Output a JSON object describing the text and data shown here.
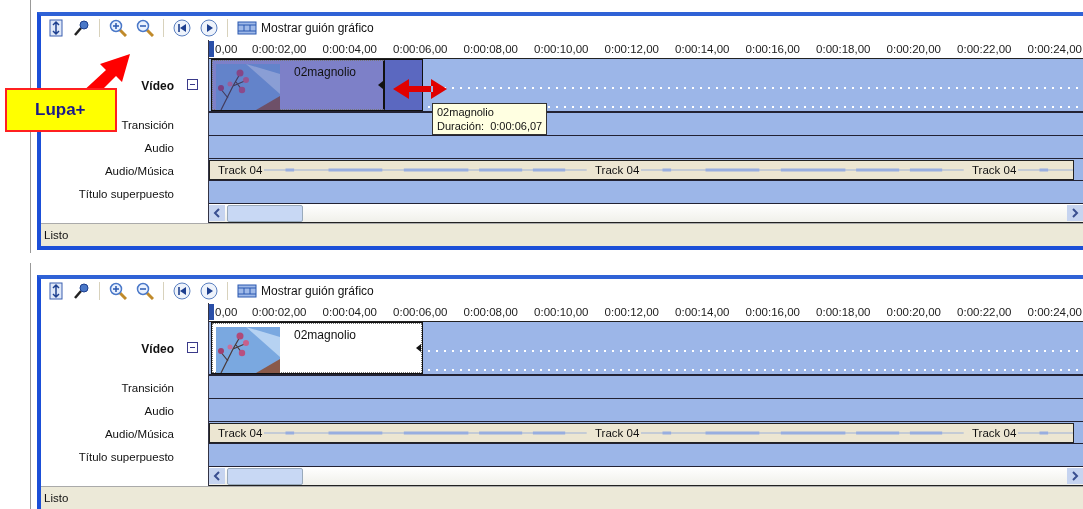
{
  "callout": {
    "text": "Lupa+"
  },
  "panels": [
    {
      "toolbar_label": "Mostrar guión gráfico",
      "ruler": [
        "0,00",
        "0:00:02,00",
        "0:00:04,00",
        "0:00:06,00",
        "0:00:08,00",
        "0:00:10,00",
        "0:00:12,00",
        "0:00:14,00",
        "0:00:16,00",
        "0:00:18,00",
        "0:00:20,00",
        "0:00:22,00",
        "0:00:24,00"
      ],
      "tracks": [
        {
          "kind": "video",
          "label": "Vídeo",
          "expanded": true,
          "clip": {
            "title": "02magnolio",
            "selected": true
          },
          "tooltip": [
            "02magnolio",
            "Duración:  0:00:06,07"
          ]
        },
        {
          "kind": "transition",
          "label": "Transición"
        },
        {
          "kind": "audio",
          "label": "Audio"
        },
        {
          "kind": "music",
          "label": "Audio/Música",
          "clips": [
            "Track 04",
            "Track 04",
            "Track 04"
          ]
        },
        {
          "kind": "title",
          "label": "Título superpuesto"
        }
      ],
      "trim_arrow": true,
      "status": "Listo"
    },
    {
      "toolbar_label": "Mostrar guión gráfico",
      "ruler": [
        "0,00",
        "0:00:02,00",
        "0:00:04,00",
        "0:00:06,00",
        "0:00:08,00",
        "0:00:10,00",
        "0:00:12,00",
        "0:00:14,00",
        "0:00:16,00",
        "0:00:18,00",
        "0:00:20,00",
        "0:00:22,00",
        "0:00:24,00"
      ],
      "tracks": [
        {
          "kind": "video",
          "label": "Vídeo",
          "expanded": true,
          "clip": {
            "title": "02magnolio",
            "selected": false
          }
        },
        {
          "kind": "transition",
          "label": "Transición"
        },
        {
          "kind": "audio",
          "label": "Audio"
        },
        {
          "kind": "music",
          "label": "Audio/Música",
          "clips": [
            "Track 04",
            "Track 04",
            "Track 04"
          ]
        },
        {
          "kind": "title",
          "label": "Título superpuesto"
        }
      ],
      "status": "Listo"
    }
  ]
}
